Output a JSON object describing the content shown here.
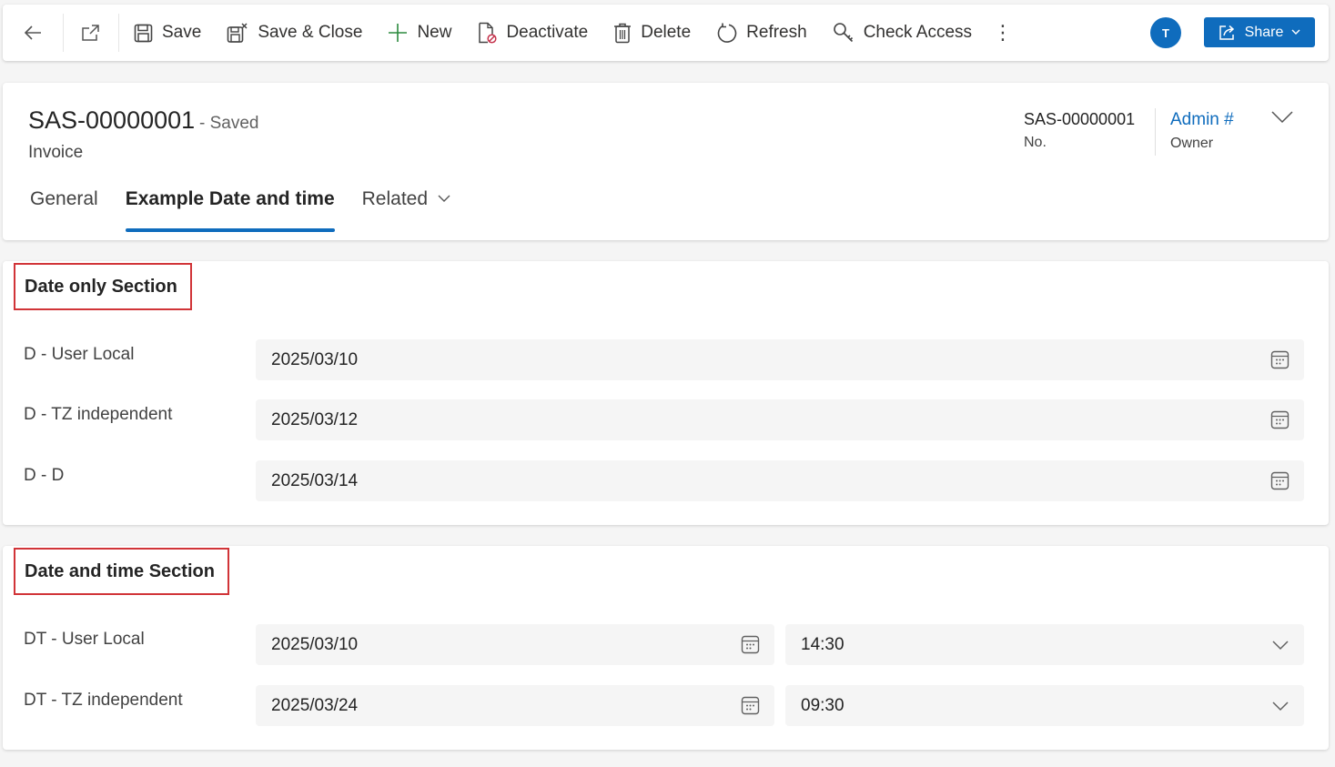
{
  "toolbar": {
    "save_label": "Save",
    "save_close_label": "Save & Close",
    "new_label": "New",
    "deactivate_label": "Deactivate",
    "delete_label": "Delete",
    "refresh_label": "Refresh",
    "check_access_label": "Check Access",
    "more_label": "⋮",
    "avatar_initial": "T",
    "share_label": "Share",
    "accent_color": "#0f6cbd"
  },
  "header": {
    "record_title": "SAS-00000001",
    "status": "- Saved",
    "entity": "Invoice",
    "fields": [
      {
        "value": "SAS-00000001",
        "label": "No."
      },
      {
        "value": "Admin #",
        "label": "Owner"
      }
    ]
  },
  "tabs": [
    {
      "label": "General",
      "active": false
    },
    {
      "label": "Example Date and time",
      "active": true
    },
    {
      "label": "Related",
      "active": false
    }
  ],
  "sections": [
    {
      "title": "Date only Section",
      "rows": [
        {
          "label": "D - User Local",
          "date": "2025/03/10"
        },
        {
          "label": "D - TZ independent",
          "date": "2025/03/12"
        },
        {
          "label": "D - D",
          "date": "2025/03/14"
        }
      ]
    },
    {
      "title": "Date and time Section",
      "rows": [
        {
          "label": "DT - User Local",
          "date": "2025/03/10",
          "time": "14:30"
        },
        {
          "label": "DT - TZ independent",
          "date": "2025/03/24",
          "time": "09:30"
        }
      ]
    }
  ],
  "highlight_color": "#d13438"
}
